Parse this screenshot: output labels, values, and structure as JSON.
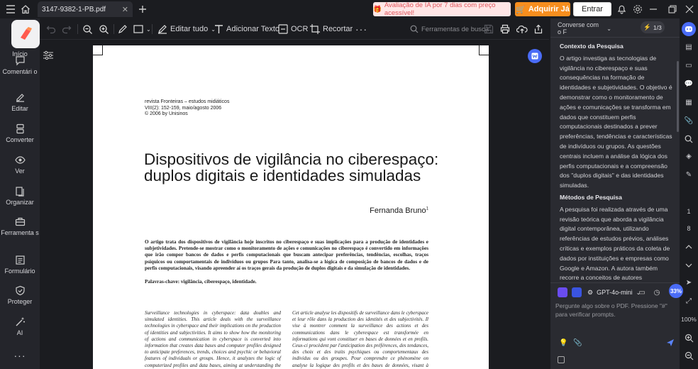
{
  "titlebar": {
    "tab_title": "3147-9382-1-PB.pdf",
    "promo_text": "Avaliação de IA por 7 dias com preço acessível!",
    "buy_label": "Adquirir Já",
    "login_label": "Entrar"
  },
  "sidebar": {
    "items": [
      {
        "label": "Início",
        "icon": "home-logo-icon"
      },
      {
        "label": "Comentári o",
        "icon": "comment-icon"
      },
      {
        "label": "Editar",
        "icon": "edit-icon"
      },
      {
        "label": "Converter",
        "icon": "convert-icon"
      },
      {
        "label": "Ver",
        "icon": "eye-icon"
      },
      {
        "label": "Organizar",
        "icon": "organize-icon"
      },
      {
        "label": "Ferramenta s",
        "icon": "toolbox-icon"
      },
      {
        "label": "Formulário",
        "icon": "form-icon"
      },
      {
        "label": "Proteger",
        "icon": "shield-icon"
      },
      {
        "label": "AI",
        "icon": "ai-wand-icon"
      }
    ]
  },
  "toolbar": {
    "edit_all": "Editar tudo",
    "add_text": "Adicionar Texto",
    "ocr": "OCR",
    "crop": "Recortar",
    "search_tools": "Ferramentas de busca"
  },
  "document": {
    "journal": [
      "revista Fronteiras – estudos midiáticos",
      "VIII(2): 152-159, maio/agosto 2006",
      "© 2006 by Unisinos"
    ],
    "title_line1": "Dispositivos de vigilância no ciberespaço:",
    "title_line2": "duplos digitais e identidades simuladas",
    "author": "Fernanda Bruno",
    "author_sup": "1",
    "abstract": "O artigo trata dos dispositivos de vigilância hoje inscritos no ciberespaço e suas implicações para a produção de identidades e subjetividades. Pretende-se mostrar como o monitoramento de ações e comunicações no ciberespaço é convertido em informações que irão compor bancos de dados e perfis computacionais que buscam antecipar preferências, tendências, escolhas, traços psíquicos ou comportamentais de indivíduos ou grupos Para tanto, analisa-se a lógica de composição de bancos de dados e de perfis computacionais, visando apreender aí os traços gerais da produção de duplos digitais e da simulação de identidades.",
    "keywords": "Palavras-chave: vigilância, ciberespaço, identidade.",
    "col_en": "Surveillance technologies in cyberspace: data doubles and simulated identities. This article deals with the surveillance technologies in cyberspace and their implications on the production of identities and subjectivities. It aims to show how the monitoring of actions and communication in cyberspace is converted into information that creates data bases and computer profiles designed to anticipate preferences, trends, choices and psychic or behavioral features of individuals or groups. Hence, it analyzes the logic of computerized profiles and data bases, aiming at understanding the production",
    "col_fr": "Cet article analyse les dispositifs de surveillance dans le cyberspace et leur rôle dans la production des identités et des subjectivités. Il vise à montrer comment la surveillance des actions et des communications dans le cyberespace est transformée en informations qui vont constituer en bases de données et en profils. Ceux-ci procèdent par l'anticipation des préférences, des tendances, des choix et des traits psychiques ou comportementaux des individus ou des groupes. Pour comprendre ce phénomène on analyse la logique des profils et des bases de données, visant à appréhender la production des doubles digitaux et la"
  },
  "chat": {
    "model_selector": "Converse com o F",
    "counter": "1/3",
    "section1_title": "Contexto da Pesquisa",
    "section1_text": "O artigo investiga as tecnologias de vigilância no ciberespaço e suas consequências na formação de identidades e subjetividades. O objetivo é demonstrar como o monitoramento de ações e comunicações se transforma em dados que constituem perfis computacionais destinados a prever preferências, tendências e características de indivíduos ou grupos. As questões centrais incluem a análise da lógica dos perfis computacionais e a compreensão dos \"duplos digitais\" e das identidades simuladas.",
    "section2_title": "Métodos de Pesquisa",
    "section2_text": "A pesquisa foi realizada através de uma revisão teórica que aborda a vigilância digital contemporânea, utilizando referências de estudos prévios, análises críticas e exemplos práticos da coleta de dados por instituições e empresas como Google e Amazon. A autora também recorre a conceitos de autores reconhecidos, como Foucault, para fundamentar a discussão sobre vigilância e identidade.",
    "model_name": "GPT-4o-mini",
    "input_placeholder": "Pergunte algo sobre o PDF. Pressione \"#\" para verificar prompts."
  },
  "rail": {
    "page_current": "1",
    "page_total": "8",
    "zoom": "100%",
    "progress_badge": "33%"
  },
  "colors": {
    "accent_orange": "#f78e1e",
    "promo_bg": "#ffe6e6",
    "badge_blue": "#4a6cf7"
  }
}
